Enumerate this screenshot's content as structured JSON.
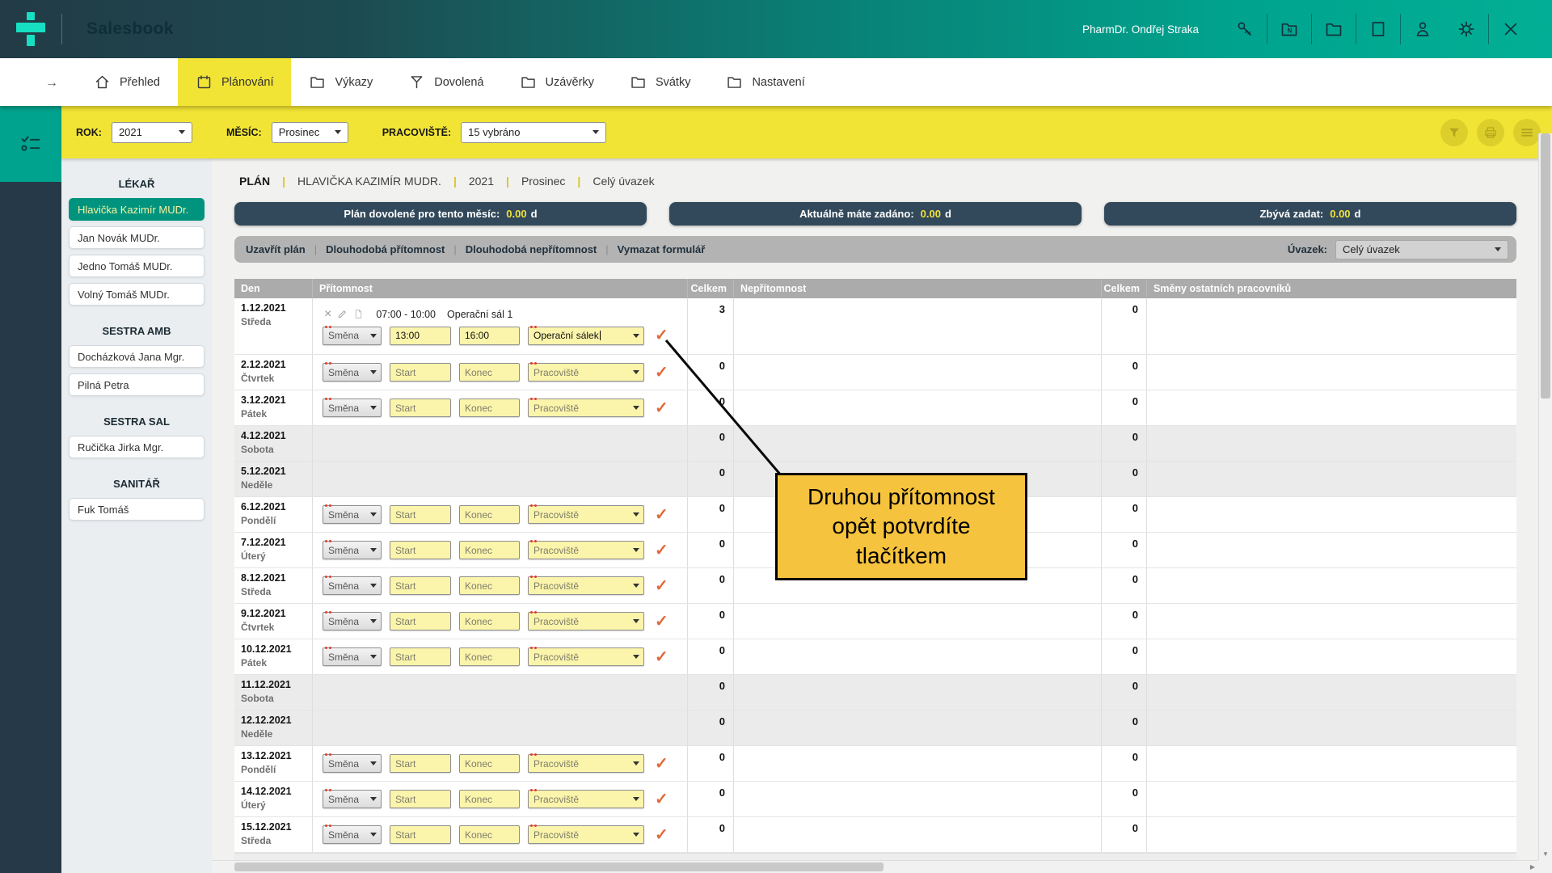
{
  "header": {
    "app_title": "Salesbook",
    "user_name": "PharmDr. Ondřej Straka",
    "icons": [
      "key",
      "folder-n",
      "folder",
      "square",
      "person",
      "gear",
      "close"
    ]
  },
  "nav": {
    "tabs": [
      {
        "label": "Přehled",
        "icon": "home",
        "active": false
      },
      {
        "label": "Plánování",
        "icon": "calendar",
        "active": true
      },
      {
        "label": "Výkazy",
        "icon": "folder",
        "active": false
      },
      {
        "label": "Dovolená",
        "icon": "funnel",
        "active": false
      },
      {
        "label": "Uzávěrky",
        "icon": "folder",
        "active": false
      },
      {
        "label": "Svátky",
        "icon": "folder",
        "active": false
      },
      {
        "label": "Nastavení",
        "icon": "folder",
        "active": false
      }
    ]
  },
  "filterbar": {
    "fields": [
      {
        "label": "ROK:",
        "value": "2021"
      },
      {
        "label": "MĚSÍC:",
        "value": "Prosinec"
      },
      {
        "label": "PRACOVIŠTĚ:",
        "value": "15 vybráno"
      }
    ],
    "action_icons": [
      "filter",
      "printer",
      "menu"
    ]
  },
  "sidebar": {
    "groups": [
      {
        "title": "LÉKAŘ",
        "items": [
          {
            "name": "Hlavička Kazimír MUDr.",
            "selected": true
          },
          {
            "name": "Jan Novák MUDr.",
            "selected": false
          },
          {
            "name": "Jedno Tomáš MUDr.",
            "selected": false
          },
          {
            "name": "Volný Tomáš MUDr.",
            "selected": false
          }
        ]
      },
      {
        "title": "SESTRA AMB",
        "items": [
          {
            "name": "Docházková Jana Mgr.",
            "selected": false
          },
          {
            "name": "Pilná Petra",
            "selected": false
          }
        ]
      },
      {
        "title": "SESTRA SAL",
        "items": [
          {
            "name": "Ručička Jirka Mgr.",
            "selected": false
          }
        ]
      },
      {
        "title": "SANITÁŘ",
        "items": [
          {
            "name": "Fuk Tomáš",
            "selected": false
          }
        ]
      }
    ]
  },
  "plan": {
    "breadcrumb": [
      "PLÁN",
      "HLAVIČKA KAZIMÍR MUDR.",
      "2021",
      "Prosinec",
      "Celý úvazek"
    ],
    "stats": [
      {
        "label": "Plán dovolené pro tento měsíc:",
        "value": "0.00",
        "unit": "d"
      },
      {
        "label": "Aktuálně máte zadáno:",
        "value": "0.00",
        "unit": "d"
      },
      {
        "label": "Zbývá zadat:",
        "value": "0.00",
        "unit": "d"
      }
    ],
    "toolbar": {
      "actions": [
        "Uzavřít plán",
        "Dlouhodobá přítomnost",
        "Dlouhodobá nepřítomnost",
        "Vymazat formulář"
      ],
      "uvazek_label": "Úvazek:",
      "uvazek_value": "Celý úvazek"
    },
    "table": {
      "headers": [
        "Den",
        "Přítomnost",
        "Celkem",
        "Nepřítomnost",
        "Celkem",
        "Směny ostatních pracovníků"
      ],
      "form_defaults": {
        "smena": "Směna",
        "start": "Start",
        "konec": "Konec",
        "pracoviste": "Pracoviště"
      },
      "rows": [
        {
          "date": "1.12.2021",
          "day": "Středa",
          "weekend": false,
          "has_form": true,
          "entry": {
            "time": "07:00 - 10:00",
            "place": "Operační sál 1"
          },
          "start": "13:00",
          "konec": "16:00",
          "pracoviste": "Operační sálek",
          "celkem1": "3",
          "celkem2": "0"
        },
        {
          "date": "2.12.2021",
          "day": "Čtvrtek",
          "weekend": false,
          "has_form": true,
          "start": "",
          "konec": "",
          "pracoviste": "",
          "celkem1": "0",
          "celkem2": "0"
        },
        {
          "date": "3.12.2021",
          "day": "Pátek",
          "weekend": false,
          "has_form": true,
          "start": "",
          "konec": "",
          "pracoviste": "",
          "celkem1": "0",
          "celkem2": "0"
        },
        {
          "date": "4.12.2021",
          "day": "Sobota",
          "weekend": true,
          "has_form": false,
          "celkem1": "0",
          "celkem2": "0"
        },
        {
          "date": "5.12.2021",
          "day": "Neděle",
          "weekend": true,
          "has_form": false,
          "celkem1": "0",
          "celkem2": "0"
        },
        {
          "date": "6.12.2021",
          "day": "Pondělí",
          "weekend": false,
          "has_form": true,
          "start": "",
          "konec": "",
          "pracoviste": "",
          "celkem1": "0",
          "celkem2": "0"
        },
        {
          "date": "7.12.2021",
          "day": "Úterý",
          "weekend": false,
          "has_form": true,
          "start": "",
          "konec": "",
          "pracoviste": "",
          "celkem1": "0",
          "celkem2": "0"
        },
        {
          "date": "8.12.2021",
          "day": "Středa",
          "weekend": false,
          "has_form": true,
          "start": "",
          "konec": "",
          "pracoviste": "",
          "celkem1": "0",
          "celkem2": "0"
        },
        {
          "date": "9.12.2021",
          "day": "Čtvrtek",
          "weekend": false,
          "has_form": true,
          "start": "",
          "konec": "",
          "pracoviste": "",
          "celkem1": "0",
          "celkem2": "0"
        },
        {
          "date": "10.12.2021",
          "day": "Pátek",
          "weekend": false,
          "has_form": true,
          "start": "",
          "konec": "",
          "pracoviste": "",
          "celkem1": "0",
          "celkem2": "0"
        },
        {
          "date": "11.12.2021",
          "day": "Sobota",
          "weekend": true,
          "has_form": false,
          "celkem1": "0",
          "celkem2": "0"
        },
        {
          "date": "12.12.2021",
          "day": "Neděle",
          "weekend": true,
          "has_form": false,
          "celkem1": "0",
          "celkem2": "0"
        },
        {
          "date": "13.12.2021",
          "day": "Pondělí",
          "weekend": false,
          "has_form": true,
          "start": "",
          "konec": "",
          "pracoviste": "",
          "celkem1": "0",
          "celkem2": "0"
        },
        {
          "date": "14.12.2021",
          "day": "Úterý",
          "weekend": false,
          "has_form": true,
          "start": "",
          "konec": "",
          "pracoviste": "",
          "celkem1": "0",
          "celkem2": "0"
        },
        {
          "date": "15.12.2021",
          "day": "Středa",
          "weekend": false,
          "has_form": true,
          "start": "",
          "konec": "",
          "pracoviste": "",
          "celkem1": "0",
          "celkem2": "0"
        }
      ]
    }
  },
  "callout": {
    "text": "Druhou přítomnost opět potvrdíte tlačítkem"
  },
  "colors": {
    "topbar_dark": "#223B46",
    "topbar_teal": "#00A48E",
    "logo_teal": "#17DFC2",
    "accent_yellow": "#F2E434",
    "status_bar_bg": "#32495B",
    "status_value_yellow": "#F2E33C",
    "selected_item_bg": "#00947E",
    "check_orange": "#DF6A3C",
    "callout_bg": "#F6C33E",
    "field_yellow": "#FBF4AB",
    "weekend_gray": "#EBEBEB"
  }
}
